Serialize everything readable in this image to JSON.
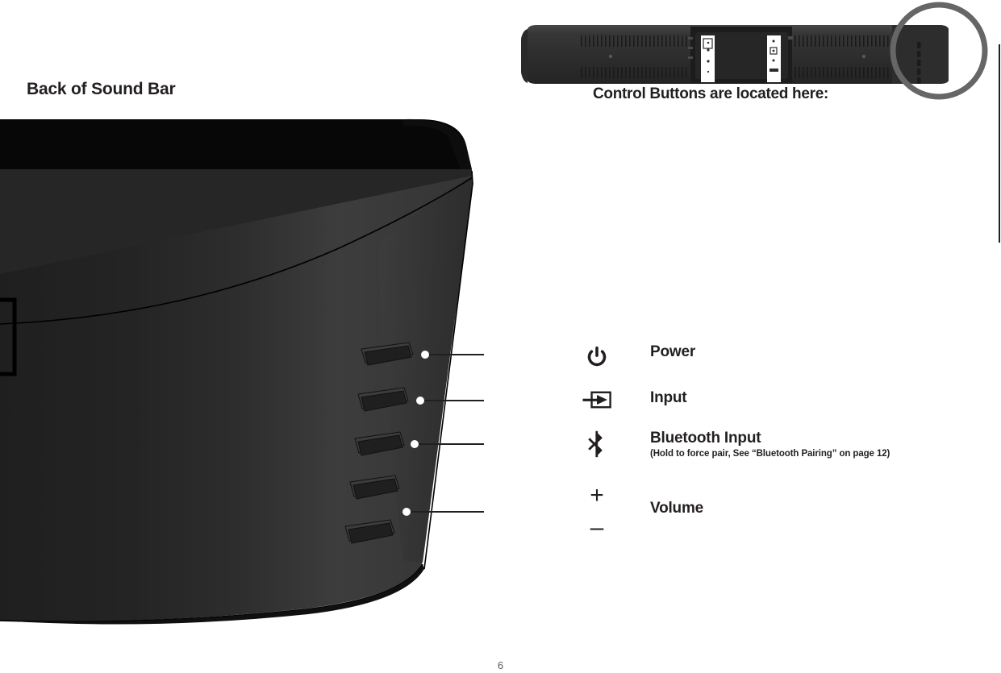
{
  "page": {
    "heading": "Back of Sound Bar",
    "number": "6"
  },
  "soundbar_figure": {
    "caption": "Control Buttons are located here:",
    "highlight_circle": "circle-highlight",
    "colors": {
      "body_dark": "#2b2b2b",
      "body_darker": "#1e1e1e",
      "body_light": "#3a3a3a",
      "circle_stroke": "#666666",
      "panel_white": "#ffffff"
    }
  },
  "product_figure": {
    "name": "back-of-sound-bar-illustration",
    "colors": {
      "top_black": "#050505",
      "face_dark": "#262626",
      "face_mid": "#333333",
      "face_light": "#3f3f3f",
      "outline": "#000000",
      "dot": "#ffffff",
      "leader_line": "#231f20"
    },
    "buttons": [
      "power-button",
      "input-button",
      "bluetooth-button",
      "volume-up-button",
      "volume-down-button"
    ]
  },
  "legend": {
    "rows": [
      {
        "icon": "power-icon",
        "label": "Power",
        "sub": ""
      },
      {
        "icon": "input-icon",
        "label": "Input",
        "sub": ""
      },
      {
        "icon": "bluetooth-icon",
        "label": "Bluetooth Input",
        "sub": "(Hold to force pair, See “Bluetooth Pairing” on page 12)"
      },
      {
        "icon": "volume-icon",
        "label": "Volume",
        "sub": "",
        "plus": "+",
        "minus": "–"
      }
    ]
  }
}
